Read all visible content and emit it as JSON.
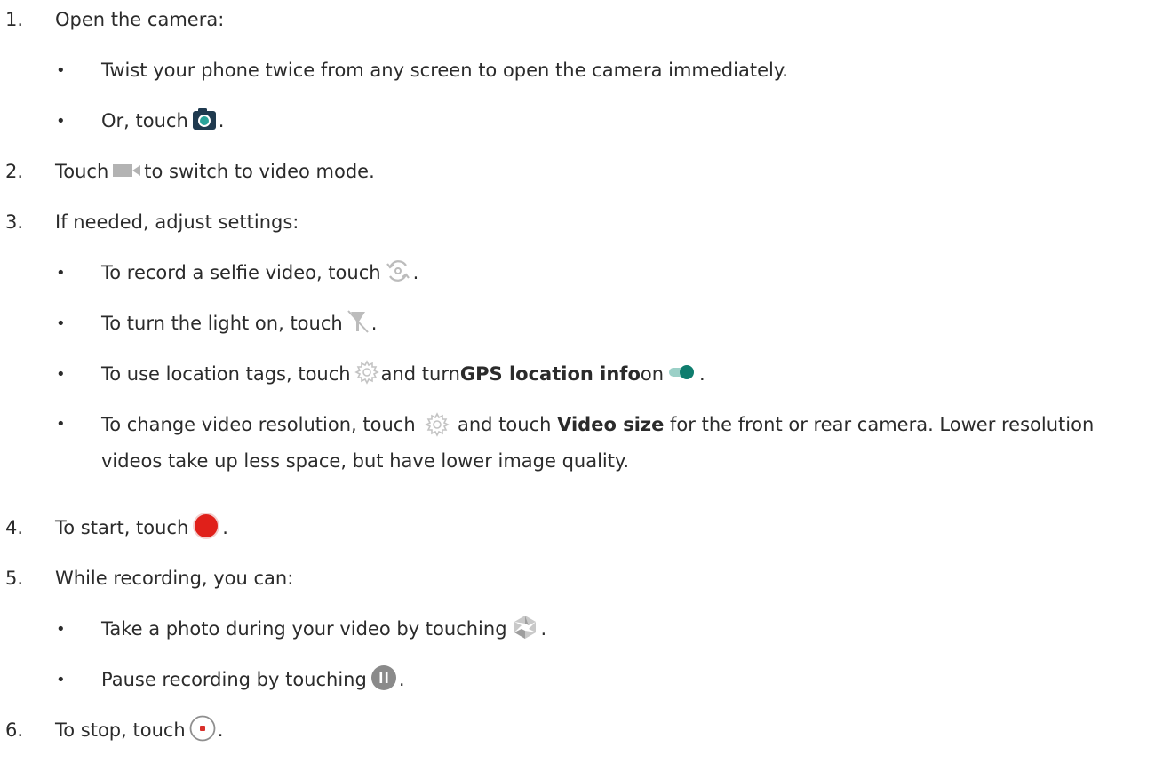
{
  "steps": [
    {
      "number": "1.",
      "text": "Open the camera:",
      "bullets": [
        {
          "text": "Twist your phone twice from any screen to open the camera immediately."
        },
        {
          "text": "Or, touch ",
          "icon": "camera-app-icon",
          "after": "."
        }
      ]
    },
    {
      "number": "2.",
      "text_before": "Touch ",
      "icon": "video-mode-icon",
      "text_after": " to switch to video mode."
    },
    {
      "number": "3.",
      "text": "If needed, adjust settings:",
      "bullets": [
        {
          "text": "To record a selfie video, touch ",
          "icon": "switch-camera-icon",
          "after": "."
        },
        {
          "text": "To turn the light on, touch ",
          "icon": "flashlight-off-icon",
          "after": "."
        },
        {
          "text": "To use location tags, touch ",
          "icon": "settings-gear-icon",
          "middle": " and turn ",
          "bold": "GPS location info",
          "after_bold": " on ",
          "icon2": "toggle-on-icon",
          "after": "."
        },
        {
          "text": "To change video resolution, touch ",
          "icon": "settings-gear-icon",
          "middle": " and touch ",
          "bold": "Video size",
          "after": " for the front or rear camera. Lower resolution videos take up less space, but have lower image quality."
        }
      ]
    },
    {
      "number": "4.",
      "text_before": "To start, touch ",
      "icon": "record-button-icon",
      "text_after": "."
    },
    {
      "number": "5.",
      "text": "While recording, you can:",
      "bullets": [
        {
          "text": "Take a photo during your video by touching ",
          "icon": "shutter-icon",
          "after": "."
        },
        {
          "text": "Pause recording by touching ",
          "icon": "pause-button-icon",
          "after": "."
        }
      ]
    },
    {
      "number": "6.",
      "text_before": "To stop, touch ",
      "icon": "stop-button-icon",
      "text_after": "."
    }
  ],
  "bullet_char": "•",
  "colors": {
    "text": "#2b2b2b",
    "camera_icon_bg": "#1f3a4f",
    "camera_lens": "#2aa39a",
    "video_icon": "#b3b3b3",
    "light_icon_gray": "#bcbcbc",
    "toggle_track": "#9bd0c7",
    "toggle_knob": "#0f7d6e",
    "record_red": "#e0201a",
    "pause_gray": "#8a8a8a",
    "stop_red": "#d9302b"
  }
}
